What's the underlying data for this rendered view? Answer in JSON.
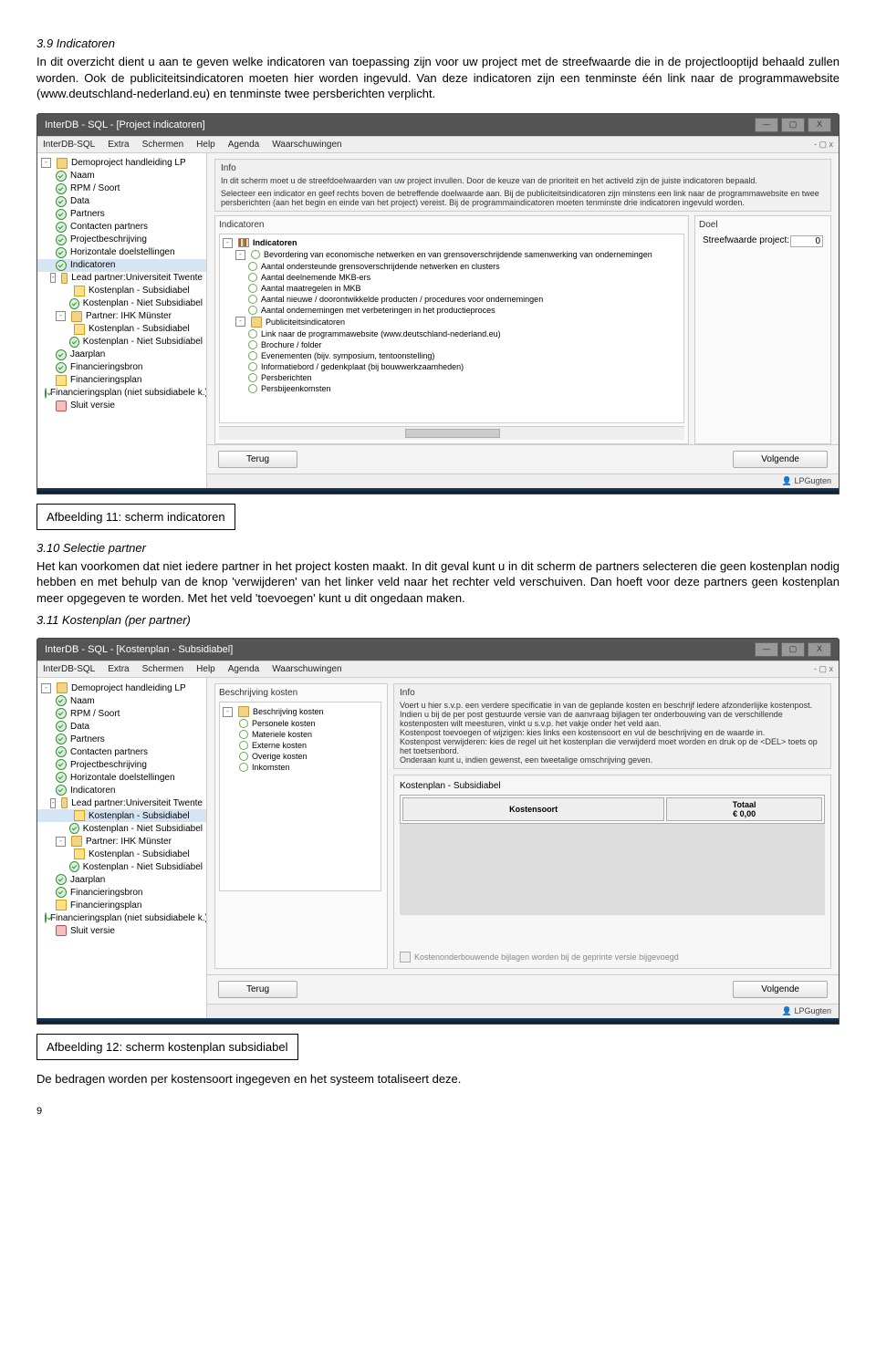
{
  "sec39_title": "3.9 Indicatoren",
  "sec39_body": "In dit overzicht dient u aan te geven welke indicatoren van toepassing zijn voor uw project met de streefwaarde die in de projectlooptijd behaald zullen worden. Ook de publiciteitsindicatoren moeten hier worden ingevuld. Van deze indicatoren zijn een tenminste één link naar de programmawebsite (www.deutschland-nederland.eu) en tenminste twee persberichten verplicht.",
  "caption11": "Afbeelding 11: scherm indicatoren",
  "sec310_title": "3.10 Selectie partner",
  "sec310_body": "Het kan voorkomen dat niet iedere partner in het project kosten maakt. In dit geval kunt u in dit scherm de partners selecteren die geen kostenplan nodig hebben en met behulp van de knop 'verwijderen' van het linker veld naar het rechter veld verschuiven. Dan hoeft voor deze partners geen kostenplan meer opgegeven te worden. Met het veld 'toevoegen' kunt u dit ongedaan maken.",
  "sec311_title": "3.11 Kostenplan (per partner)",
  "caption12": "Afbeelding 12: scherm kostenplan subsidiabel",
  "closing": "De bedragen worden per kostensoort ingegeven en het systeem totaliseert deze.",
  "page_num": "9",
  "win1": {
    "title": "InterDB - SQL - [Project indicatoren]",
    "menu": [
      "InterDB-SQL",
      "Extra",
      "Schermen",
      "Help",
      "Agenda",
      "Waarschuwingen"
    ],
    "info_title": "Info",
    "info_line1": "In dit scherm moet u de streefdoelwaarden van uw project invullen. Door de keuze van de prioriteit en het activeld zijn de juiste indicatoren bepaald.",
    "info_line2": "Selecteer een indicator en geef rechts boven de betreffende doelwaarde aan. Bij de publiciteitsindicatoren zijn minstens een link naar de programmawebsite en twee persberichten (aan het begin en einde van het project) vereist. Bij de programmaindicatoren moeten tenminste drie indicatoren ingevuld worden.",
    "group_ind": "Indicatoren",
    "group_doel": "Doel",
    "doel_label": "Streefwaarde project:",
    "doel_value": "0",
    "ind_root": "Indicatoren",
    "ind_items": [
      "Bevordering van economische netwerken en van grensoverschrijdende samenwerking van ondernemingen",
      "Aantal ondersteunde grensoverschrijdende netwerken en clusters",
      "Aantal deelnemende MKB-ers",
      "Aantal maatregelen in MKB",
      "Aantal nieuwe / doorontwikkelde producten / procedures voor ondernemingen",
      "Aantal ondernemingen met verbeteringen in het productieproces"
    ],
    "pub_root": "Publiciteitsindicatoren",
    "pub_items": [
      "Link naar de programmawebsite (www.deutschland-nederland.eu)",
      "Brochure / folder",
      "Evenementen (bijv. symposium, tentoonstelling)",
      "Informatiebord / gedenkplaat (bij bouwwerkzaamheden)",
      "Persberichten",
      "Persbijeenkomsten"
    ],
    "btn_back": "Terug",
    "btn_next": "Volgende",
    "status": "LPGugten"
  },
  "win2": {
    "title": "InterDB - SQL - [Kostenplan - Subsidiabel]",
    "menu": [
      "InterDB-SQL",
      "Extra",
      "Schermen",
      "Help",
      "Agenda",
      "Waarschuwingen"
    ],
    "group_besch": "Beschrijving kosten",
    "mid_root": "Beschrijving kosten",
    "mid_items": [
      "Personele kosten",
      "Materiele kosten",
      "Externe kosten",
      "Overige kosten",
      "Inkomsten"
    ],
    "info_title": "Info",
    "info_text": "Voert u hier s.v.p. een verdere specificatie in van de geplande kosten en beschrijf iedere afzonderlijke kostenpost. Indien u bij de per post gestuurde versie van de aanvraag bijlagen ter onderbouwing van de verschillende kostenposten wilt meesturen, vinkt u s.v.p. het vakje onder het veld aan.\nKostenpost toevoegen of wijzigen: kies links een kostensoort en vul de beschrijving en de waarde in.\nKostenpost verwijderen: kies de regel uit het kostenplan die verwijderd moet worden en druk op de <DEL> toets op het toetsenbord.\nOnderaan kunt u, indien gewenst, een tweetalige omschrijving geven.",
    "panel_title": "Kostenplan - Subsidiabel",
    "th1": "Kostensoort",
    "th2": "Totaal",
    "th2b": "€ 0,00",
    "chk_label": "Kostenonderbouwende bijlagen worden bij de geprinte versie bijgevoegd",
    "btn_back": "Terug",
    "btn_next": "Volgende",
    "status": "LPGugten"
  },
  "sidebar": {
    "root": "Demoproject handleiding LP",
    "items": [
      {
        "i": "ok",
        "t": "Naam"
      },
      {
        "i": "ok",
        "t": "RPM / Soort"
      },
      {
        "i": "ok",
        "t": "Data"
      },
      {
        "i": "ok",
        "t": "Partners"
      },
      {
        "i": "ok",
        "t": "Contacten partners"
      },
      {
        "i": "ok",
        "t": "Projectbeschrijving"
      },
      {
        "i": "ok",
        "t": "Horizontale doelstellingen"
      },
      {
        "i": "ok",
        "t": "Indicatoren",
        "sel": true
      },
      {
        "i": "folder",
        "t": "Lead partner:Universiteit Twente",
        "exp": "-"
      },
      {
        "i": "warn",
        "t": "Kostenplan - Subsidiabel",
        "ind": 2
      },
      {
        "i": "ok",
        "t": "Kostenplan - Niet Subsidiabel",
        "ind": 2
      },
      {
        "i": "folder",
        "t": "Partner: IHK Münster",
        "exp": "-"
      },
      {
        "i": "warn",
        "t": "Kostenplan - Subsidiabel",
        "ind": 2
      },
      {
        "i": "ok",
        "t": "Kostenplan - Niet Subsidiabel",
        "ind": 2
      },
      {
        "i": "ok",
        "t": "Jaarplan"
      },
      {
        "i": "ok",
        "t": "Financieringsbron"
      },
      {
        "i": "warn",
        "t": "Financieringsplan"
      },
      {
        "i": "ok",
        "t": "Financieringsplan (niet subsidiabele k.)"
      },
      {
        "i": "stop",
        "t": "Sluit versie"
      }
    ]
  },
  "sidebar2_sel": "Kostenplan - Subsidiabel"
}
